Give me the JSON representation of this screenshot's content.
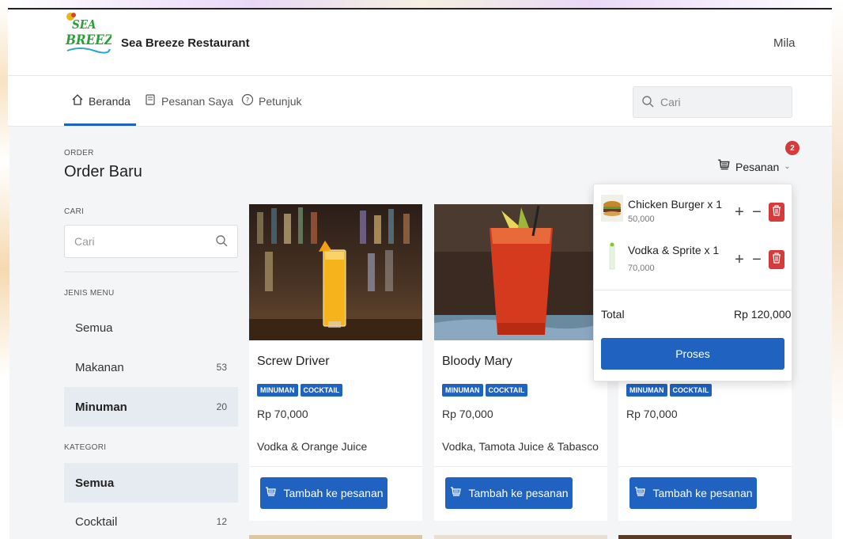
{
  "header": {
    "brand": "Sea Breeze Restaurant",
    "user": "Mila",
    "logo_text": "SEA BREEZE"
  },
  "nav": {
    "items": [
      {
        "label": "Beranda",
        "icon": "home-icon"
      },
      {
        "label": "Pesanan Saya",
        "icon": "receipt-icon"
      },
      {
        "label": "Petunjuk",
        "icon": "help-circle-icon"
      }
    ],
    "search_placeholder": "Cari"
  },
  "page": {
    "overline": "ORDER",
    "title": "Order Baru"
  },
  "sidebar": {
    "search_label": "CARI",
    "search_placeholder": "Cari",
    "menu_type_label": "JENIS MENU",
    "menu_types": [
      {
        "label": "Semua",
        "count": ""
      },
      {
        "label": "Makanan",
        "count": "53"
      },
      {
        "label": "Minuman",
        "count": "20"
      }
    ],
    "category_label": "KATEGORI",
    "categories": [
      {
        "label": "Semua",
        "count": ""
      },
      {
        "label": "Cocktail",
        "count": "12"
      }
    ]
  },
  "products": [
    {
      "name": "Screw Driver",
      "tags": [
        "MINUMAN",
        "COCKTAIL"
      ],
      "price": "Rp 70,000",
      "desc": "Vodka & Orange Juice",
      "button": "Tambah ke pesanan"
    },
    {
      "name": "Bloody Mary",
      "tags": [
        "MINUMAN",
        "COCKTAIL"
      ],
      "price": "Rp 70,000",
      "desc": "Vodka, Tamota Juice & Tabasco",
      "button": "Tambah ke pesanan"
    },
    {
      "name": "",
      "tags": [
        "MINUMAN",
        "COCKTAIL"
      ],
      "price": "Rp 70,000",
      "desc": "",
      "button": "Tambah ke pesanan"
    }
  ],
  "order": {
    "button": "Pesanan",
    "count": "2",
    "items": [
      {
        "name": "Chicken Burger x 1",
        "price": "50,000"
      },
      {
        "name": "Vodka & Sprite x 1",
        "price": "70,000"
      }
    ],
    "total_label": "Total",
    "total_value": "Rp 120,000",
    "proses": "Proses"
  },
  "colors": {
    "primary": "#1f62c0",
    "danger": "#d63a3a",
    "active_bg": "#e6ebf2"
  }
}
